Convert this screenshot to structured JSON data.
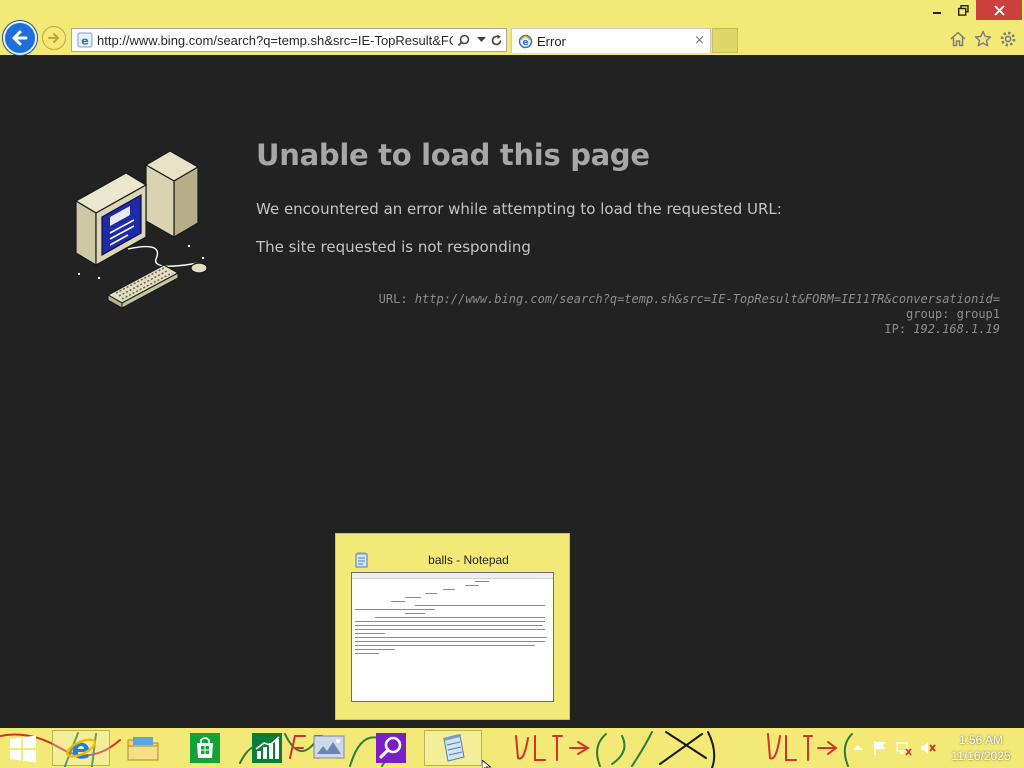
{
  "browser": {
    "address_url": "http://www.bing.com/search?q=temp.sh&src=IE-TopResult&FORM",
    "tab_title": "Error",
    "tab_close": "×"
  },
  "error_page": {
    "title": "Unable to load this page",
    "message_1": "We encountered an error while attempting to load the requested URL:",
    "message_2": "The site requested is not responding",
    "details": {
      "url_label": "URL:",
      "url_value": "http://www.bing.com/search?q=temp.sh&src=IE-TopResult&FORM=IE11TR&conversationid=",
      "group_label": "group:",
      "group_value": "group1",
      "ip_label": "IP:",
      "ip_value": "192.168.1.19"
    }
  },
  "notepad_thumbnail": {
    "title": "balls - Notepad"
  },
  "taskbar": {
    "items": [
      "start",
      "internet-explorer",
      "file-explorer",
      "store",
      "finance",
      "photos",
      "search",
      "notepad"
    ]
  },
  "clock": {
    "time": "1:56 AM",
    "date": "11/16/2025"
  },
  "colors": {
    "chrome": "#f2e977",
    "page_bg": "#222222",
    "title_text": "#a7a7a7",
    "back_button": "#1e6fd9",
    "close_button": "#c9403c",
    "scribble": "#d0342c"
  }
}
